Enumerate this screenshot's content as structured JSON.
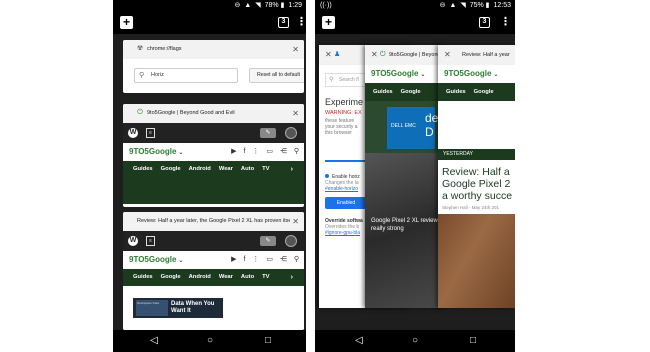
{
  "left_phone": {
    "status": {
      "time": "1:29",
      "battery": "78%"
    },
    "tab_count": "3",
    "tabs": [
      {
        "title": "chrome://flags",
        "search_value": "Horiz",
        "reset_button": "Reset all to default"
      },
      {
        "title": "9to5Google | Beyond Good and Evil",
        "logo": "9TO5Google",
        "nav": [
          "Guides",
          "Google",
          "Android",
          "Wear",
          "Auto",
          "TV"
        ]
      },
      {
        "title": "Review: Half a year later, the Google Pixel 2 XL has proven itself",
        "logo": "9TO5Google",
        "nav": [
          "Guides",
          "Google",
          "Android",
          "Wear",
          "Auto",
          "TV"
        ],
        "ad_title": "Data When You Want It",
        "ad_small": "Rackspace Data"
      }
    ]
  },
  "right_phone": {
    "status": {
      "time": "12:53",
      "battery": "75%"
    },
    "tab_count": "3",
    "tabs": [
      {
        "title": "",
        "search_placeholder": "Search fl",
        "heading": "Experime",
        "warning": "WARNING: EX",
        "desc": [
          "these feature",
          "your security a",
          "this browser"
        ],
        "tab_label": "Ava",
        "flag_name": "Enable horiz",
        "flag_sub": "Changes the la",
        "flag_link": "#enable-horizo",
        "enable_button": "Enabled",
        "override_title": "Override softwa",
        "override_sub": "Overrides the b",
        "override_link": "#ignore-gpu-bla"
      },
      {
        "title": "9to5Google | Beyond",
        "logo": "9TO5Google",
        "nav": [
          "Guides",
          "Google"
        ],
        "dell_text": "DELL EMC",
        "dell_big": "de\nD",
        "caption": "Google Pixel 2 XL review, a really strong"
      },
      {
        "title": "Review: Half a year",
        "logo": "9TO5Google",
        "nav": [
          "Guides",
          "Google"
        ],
        "section": "YESTERDAY",
        "headline": [
          "Review: Half a",
          "Google Pixel 2",
          "a worthy succe"
        ],
        "byline": "Stephen Hall  -  May 24th 201"
      }
    ]
  }
}
